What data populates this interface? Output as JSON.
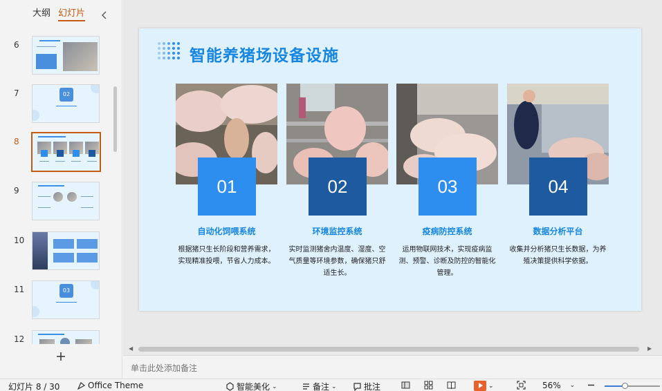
{
  "left_panel": {
    "tabs": {
      "outline": "大纲",
      "slides": "幻灯片"
    },
    "thumbnails": [
      {
        "num": "6"
      },
      {
        "num": "7",
        "badge": "02"
      },
      {
        "num": "8"
      },
      {
        "num": "9"
      },
      {
        "num": "10"
      },
      {
        "num": "11",
        "badge": "03"
      },
      {
        "num": "12"
      }
    ],
    "active_slide_num": "8"
  },
  "slide": {
    "title": "智能养猪场设备设施",
    "cards": [
      {
        "num": "01",
        "title": "自动化饲喂系统",
        "desc": "根据猪只生长阶段和营养需求，实现精准投喂，节省人力成本。",
        "box_color": "#2d8ef0"
      },
      {
        "num": "02",
        "title": "环境监控系统",
        "desc": "实时监测猪舍内温度、湿度、空气质量等环境参数，确保猪只舒适生长。",
        "box_color": "#1e5aa0"
      },
      {
        "num": "03",
        "title": "疫病防控系统",
        "desc": "运用物联网技术，实现疫病监测、预警、诊断及防控的智能化管理。",
        "box_color": "#2d8ef0"
      },
      {
        "num": "04",
        "title": "数据分析平台",
        "desc": "收集并分析猪只生长数据，为养殖决策提供科学依据。",
        "box_color": "#1e5aa0"
      }
    ]
  },
  "notes": {
    "placeholder": "单击此处添加备注"
  },
  "status": {
    "slide_counter": "幻灯片 8 / 30",
    "theme": "Office Theme",
    "beautify": "智能美化",
    "notes": "备注",
    "comments": "批注",
    "zoom": "56%",
    "zoom_level": 0.36
  },
  "colors": {
    "accent": "#1686e0",
    "active_tab": "#c55a11",
    "slide_bg": "#dff1fd"
  }
}
